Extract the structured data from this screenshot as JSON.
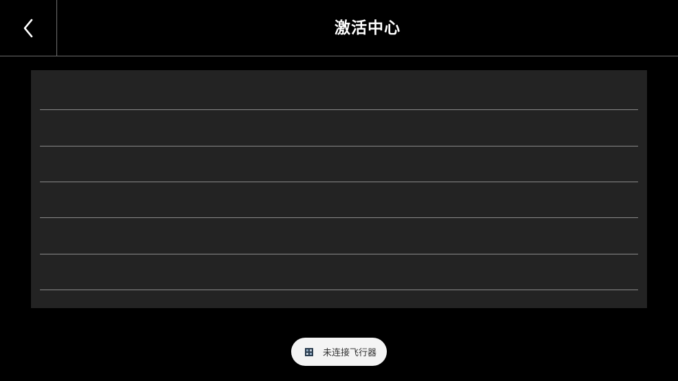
{
  "header": {
    "title": "激活中心",
    "back_icon": "chevron-left-icon"
  },
  "panel": {
    "rows": [
      "",
      "",
      "",
      "",
      "",
      ""
    ]
  },
  "toast": {
    "icon": "app-icon",
    "text": "未连接飞行器"
  },
  "colors": {
    "background": "#000000",
    "panel": "#232323",
    "divider": "#8a8a8a",
    "toast_bg": "#f4f4f4",
    "toast_text": "#333333"
  }
}
